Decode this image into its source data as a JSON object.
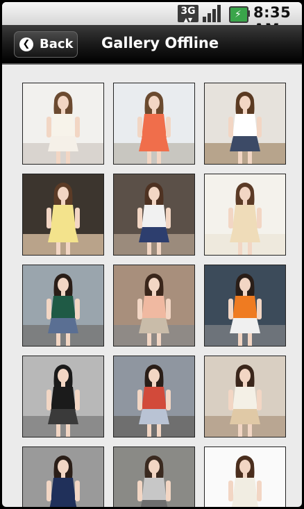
{
  "status_bar": {
    "network": "3G",
    "time": "8:35",
    "ampm": "AM",
    "battery_icon": "battery-charging-icon",
    "signal_icon": "signal-icon"
  },
  "header": {
    "back_label": "Back",
    "title": "Gallery Offline"
  },
  "gallery": {
    "items": [
      {
        "bg": "#f2f1ee",
        "floor": "#d9d4cf",
        "hair": "#6b4a30",
        "top": "#f7f3ea",
        "bottom": "#f5f0e8"
      },
      {
        "bg": "#e9ecef",
        "floor": "#c8c6c0",
        "hair": "#6a4a2f",
        "top": "#f06e4b",
        "bottom": "#f06e4b"
      },
      {
        "bg": "#e6e2dc",
        "floor": "#b7a48c",
        "hair": "#5a3a22",
        "top": "#ffffff",
        "bottom": "#3c4a66"
      },
      {
        "bg": "#3c352e",
        "floor": "#b9a38a",
        "hair": "#5b3b26",
        "top": "#f3e38c",
        "bottom": "#f3e38c"
      },
      {
        "bg": "#5b5048",
        "floor": "#9b8b7c",
        "hair": "#4e3222",
        "top": "#f1f1f1",
        "bottom": "#2d3e6e"
      },
      {
        "bg": "#f4f2ec",
        "floor": "#eee9dd",
        "hair": "#5b3b26",
        "top": "#efdcb9",
        "bottom": "#efdcb9"
      },
      {
        "bg": "#9aa5ad",
        "floor": "#7d7f80",
        "hair": "#2a1e18",
        "top": "#1f5a45",
        "bottom": "#5a6f93"
      },
      {
        "bg": "#a88f7c",
        "floor": "#8f8a86",
        "hair": "#3a261b",
        "top": "#f0b9a1",
        "bottom": "#c9bca9"
      },
      {
        "bg": "#3c4b5a",
        "floor": "#6d737a",
        "hair": "#2a1e18",
        "top": "#ef7b21",
        "bottom": "#f0f0f0"
      },
      {
        "bg": "#b8b8b8",
        "floor": "#8b8b8b",
        "hair": "#1a1a1a",
        "top": "#1b1b1b",
        "bottom": "#3a3a3a"
      },
      {
        "bg": "#8f96a0",
        "floor": "#6f6f6f",
        "hair": "#2a1e18",
        "top": "#d24a3a",
        "bottom": "#b9c3d4"
      },
      {
        "bg": "#d9cfc2",
        "floor": "#b9a692",
        "hair": "#3a261b",
        "top": "#f4f0e6",
        "bottom": "#e0c9a6"
      },
      {
        "bg": "#9a9a9a",
        "floor": "#777",
        "hair": "#2a1e18",
        "top": "#20305a",
        "bottom": "#20305a"
      },
      {
        "bg": "#8a8a86",
        "floor": "#9c9a92",
        "hair": "#3a2a20",
        "top": "#c7c7c7",
        "bottom": "#6e6e6e"
      },
      {
        "bg": "#fafafa",
        "floor": "#f2f2f2",
        "hair": "#4a2e1e",
        "top": "#f1ede2",
        "bottom": "#f1ede2"
      }
    ]
  }
}
